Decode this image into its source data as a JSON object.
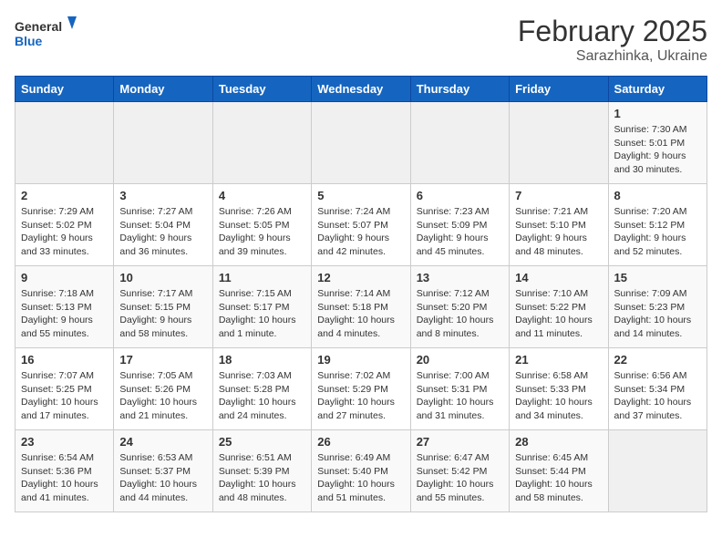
{
  "header": {
    "logo_general": "General",
    "logo_blue": "Blue",
    "title": "February 2025",
    "subtitle": "Sarazhinka, Ukraine"
  },
  "weekdays": [
    "Sunday",
    "Monday",
    "Tuesday",
    "Wednesday",
    "Thursday",
    "Friday",
    "Saturday"
  ],
  "weeks": [
    [
      {
        "day": "",
        "content": ""
      },
      {
        "day": "",
        "content": ""
      },
      {
        "day": "",
        "content": ""
      },
      {
        "day": "",
        "content": ""
      },
      {
        "day": "",
        "content": ""
      },
      {
        "day": "",
        "content": ""
      },
      {
        "day": "1",
        "content": "Sunrise: 7:30 AM\nSunset: 5:01 PM\nDaylight: 9 hours\nand 30 minutes."
      }
    ],
    [
      {
        "day": "2",
        "content": "Sunrise: 7:29 AM\nSunset: 5:02 PM\nDaylight: 9 hours\nand 33 minutes."
      },
      {
        "day": "3",
        "content": "Sunrise: 7:27 AM\nSunset: 5:04 PM\nDaylight: 9 hours\nand 36 minutes."
      },
      {
        "day": "4",
        "content": "Sunrise: 7:26 AM\nSunset: 5:05 PM\nDaylight: 9 hours\nand 39 minutes."
      },
      {
        "day": "5",
        "content": "Sunrise: 7:24 AM\nSunset: 5:07 PM\nDaylight: 9 hours\nand 42 minutes."
      },
      {
        "day": "6",
        "content": "Sunrise: 7:23 AM\nSunset: 5:09 PM\nDaylight: 9 hours\nand 45 minutes."
      },
      {
        "day": "7",
        "content": "Sunrise: 7:21 AM\nSunset: 5:10 PM\nDaylight: 9 hours\nand 48 minutes."
      },
      {
        "day": "8",
        "content": "Sunrise: 7:20 AM\nSunset: 5:12 PM\nDaylight: 9 hours\nand 52 minutes."
      }
    ],
    [
      {
        "day": "9",
        "content": "Sunrise: 7:18 AM\nSunset: 5:13 PM\nDaylight: 9 hours\nand 55 minutes."
      },
      {
        "day": "10",
        "content": "Sunrise: 7:17 AM\nSunset: 5:15 PM\nDaylight: 9 hours\nand 58 minutes."
      },
      {
        "day": "11",
        "content": "Sunrise: 7:15 AM\nSunset: 5:17 PM\nDaylight: 10 hours\nand 1 minute."
      },
      {
        "day": "12",
        "content": "Sunrise: 7:14 AM\nSunset: 5:18 PM\nDaylight: 10 hours\nand 4 minutes."
      },
      {
        "day": "13",
        "content": "Sunrise: 7:12 AM\nSunset: 5:20 PM\nDaylight: 10 hours\nand 8 minutes."
      },
      {
        "day": "14",
        "content": "Sunrise: 7:10 AM\nSunset: 5:22 PM\nDaylight: 10 hours\nand 11 minutes."
      },
      {
        "day": "15",
        "content": "Sunrise: 7:09 AM\nSunset: 5:23 PM\nDaylight: 10 hours\nand 14 minutes."
      }
    ],
    [
      {
        "day": "16",
        "content": "Sunrise: 7:07 AM\nSunset: 5:25 PM\nDaylight: 10 hours\nand 17 minutes."
      },
      {
        "day": "17",
        "content": "Sunrise: 7:05 AM\nSunset: 5:26 PM\nDaylight: 10 hours\nand 21 minutes."
      },
      {
        "day": "18",
        "content": "Sunrise: 7:03 AM\nSunset: 5:28 PM\nDaylight: 10 hours\nand 24 minutes."
      },
      {
        "day": "19",
        "content": "Sunrise: 7:02 AM\nSunset: 5:29 PM\nDaylight: 10 hours\nand 27 minutes."
      },
      {
        "day": "20",
        "content": "Sunrise: 7:00 AM\nSunset: 5:31 PM\nDaylight: 10 hours\nand 31 minutes."
      },
      {
        "day": "21",
        "content": "Sunrise: 6:58 AM\nSunset: 5:33 PM\nDaylight: 10 hours\nand 34 minutes."
      },
      {
        "day": "22",
        "content": "Sunrise: 6:56 AM\nSunset: 5:34 PM\nDaylight: 10 hours\nand 37 minutes."
      }
    ],
    [
      {
        "day": "23",
        "content": "Sunrise: 6:54 AM\nSunset: 5:36 PM\nDaylight: 10 hours\nand 41 minutes."
      },
      {
        "day": "24",
        "content": "Sunrise: 6:53 AM\nSunset: 5:37 PM\nDaylight: 10 hours\nand 44 minutes."
      },
      {
        "day": "25",
        "content": "Sunrise: 6:51 AM\nSunset: 5:39 PM\nDaylight: 10 hours\nand 48 minutes."
      },
      {
        "day": "26",
        "content": "Sunrise: 6:49 AM\nSunset: 5:40 PM\nDaylight: 10 hours\nand 51 minutes."
      },
      {
        "day": "27",
        "content": "Sunrise: 6:47 AM\nSunset: 5:42 PM\nDaylight: 10 hours\nand 55 minutes."
      },
      {
        "day": "28",
        "content": "Sunrise: 6:45 AM\nSunset: 5:44 PM\nDaylight: 10 hours\nand 58 minutes."
      },
      {
        "day": "",
        "content": ""
      }
    ]
  ]
}
